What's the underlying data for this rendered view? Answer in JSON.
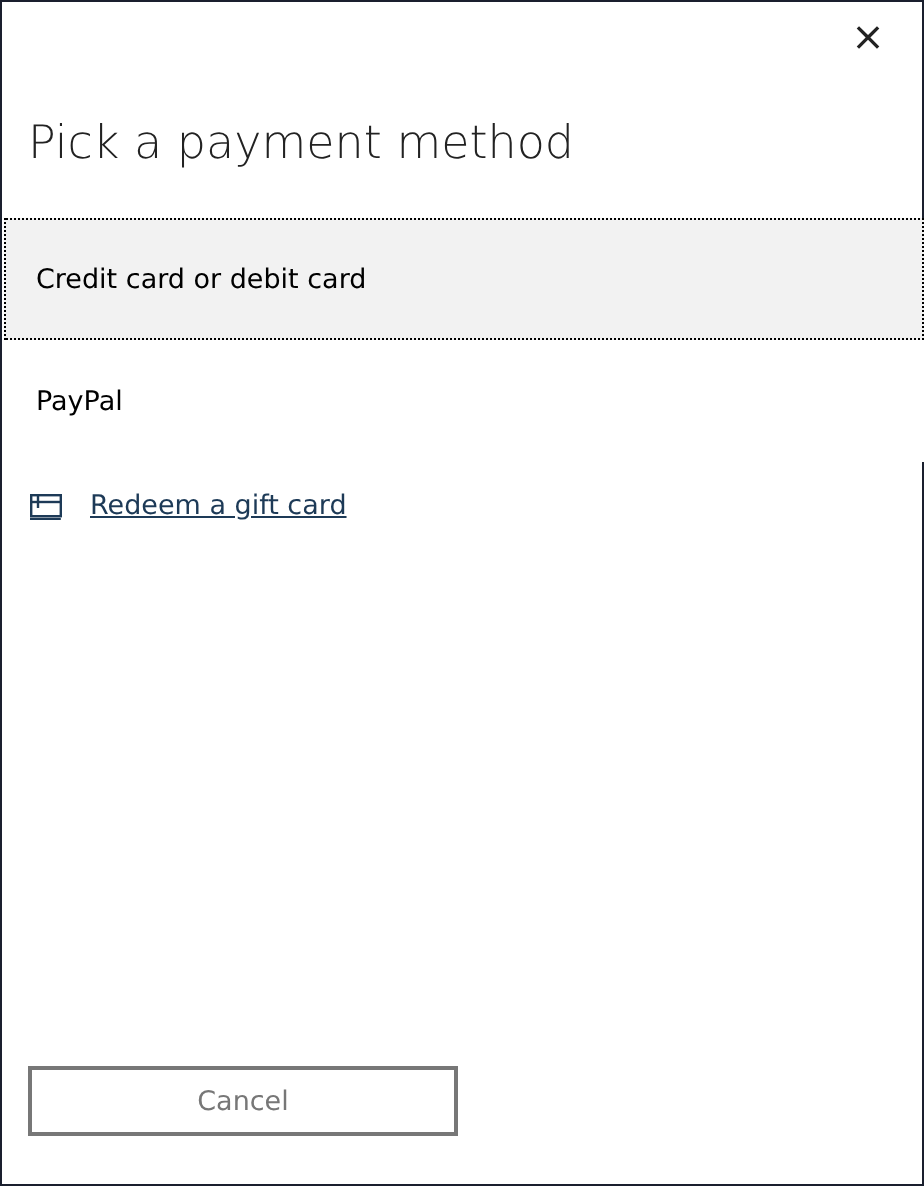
{
  "dialog": {
    "close": "×",
    "title": "Pick a payment method"
  },
  "methods": [
    {
      "label": "Credit card or debit card",
      "selected": true
    },
    {
      "label": "PayPal",
      "selected": false
    }
  ],
  "gift_link": "Redeem a gift card",
  "buttons": [
    "Cancel"
  ]
}
